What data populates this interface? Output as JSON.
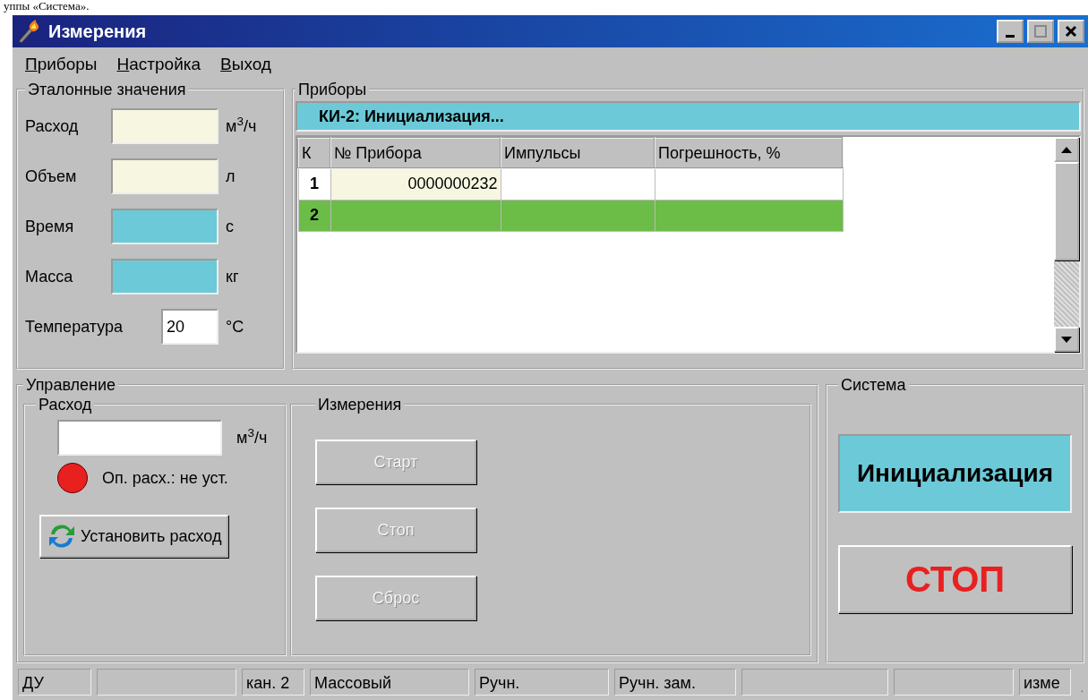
{
  "caption": "уппы «Система».",
  "window": {
    "title": "Измерения"
  },
  "menu": [
    {
      "hotkey": "П",
      "rest": "риборы"
    },
    {
      "hotkey": "Н",
      "rest": "астройка"
    },
    {
      "hotkey": "В",
      "rest": "ыход"
    }
  ],
  "reference": {
    "title": "Эталонные значения",
    "fields": [
      {
        "label": "Расход",
        "unit": "м$^{3}$/ч",
        "color": "#f7f7e1"
      },
      {
        "label": "Объем",
        "unit": "л",
        "color": "#f7f7e1"
      },
      {
        "label": "Время",
        "unit": "с",
        "color": "#6ccad8"
      },
      {
        "label": "Масса",
        "unit": "кг",
        "color": "#6ccad8"
      },
      {
        "label": "Температура",
        "unit": "°С",
        "value": "20",
        "color": "#ffffff"
      }
    ]
  },
  "devices": {
    "title": "Приборы",
    "status": "КИ-2: Инициализация...",
    "table": {
      "columns": [
        "К",
        "№ Прибора",
        "Импульсы",
        "Погрешность, %"
      ],
      "rows": [
        {
          "cells": [
            "1",
            "0000000232"
          ],
          "selected": false
        },
        {
          "cells": [
            "2"
          ],
          "selected": true
        }
      ]
    }
  },
  "control": {
    "title": "Управление",
    "flow": {
      "title": "Расход",
      "unit": "м$^{3}$/ч",
      "indicator": {
        "color": "#e82020",
        "label": "Оп. расх.: не уст."
      },
      "button": "Установить расход"
    },
    "measure": {
      "title": "Измерения",
      "buttons": [
        {
          "label": "Старт",
          "disabled": true
        },
        {
          "label": "Стоп",
          "disabled": true
        },
        {
          "label": "Сброс",
          "disabled": true
        }
      ]
    }
  },
  "system": {
    "title": "Система",
    "state": "Инициализация",
    "stop": "СТОП"
  },
  "status_bar": [
    {
      "kind": "text",
      "text": "ДУ"
    },
    {
      "kind": "empty"
    },
    {
      "kind": "text",
      "text": "кан. 2"
    },
    {
      "kind": "text",
      "text": "Массовый"
    },
    {
      "kind": "text",
      "text": "Ручн."
    },
    {
      "kind": "text",
      "text": "Ручн. зам."
    },
    {
      "kind": "empty"
    },
    {
      "kind": "empty"
    },
    {
      "kind": "text",
      "text": "изме"
    }
  ]
}
